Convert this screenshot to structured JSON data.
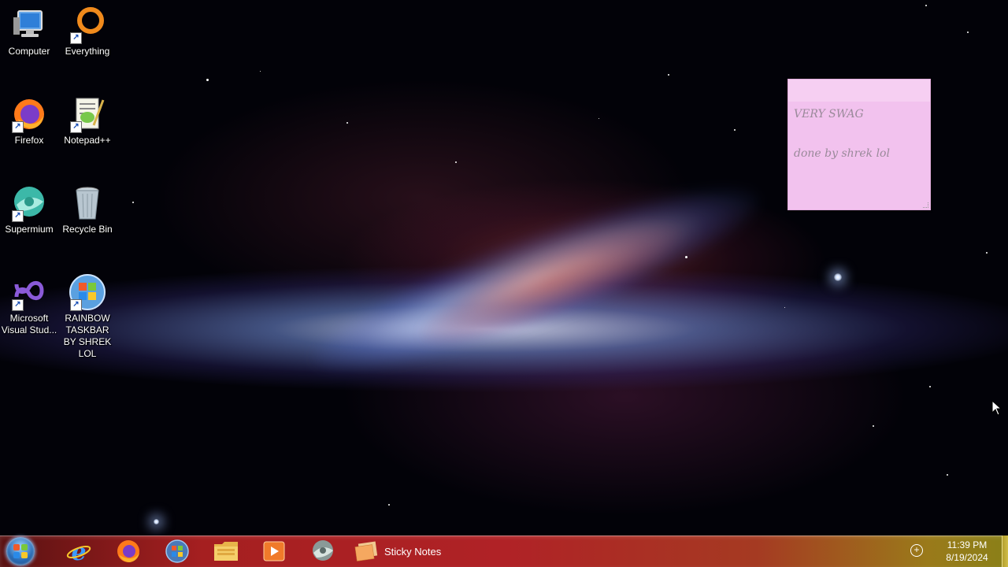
{
  "desktop_icons": [
    {
      "label": "Computer",
      "icon": "computer-icon"
    },
    {
      "label": "Everything",
      "icon": "everything-search-icon"
    },
    {
      "label": "Firefox",
      "icon": "firefox-icon"
    },
    {
      "label": "Notepad++",
      "icon": "notepad-plus-plus-icon"
    },
    {
      "label": "Supermium",
      "icon": "supermium-icon"
    },
    {
      "label": "Recycle Bin",
      "icon": "recycle-bin-icon"
    },
    {
      "label": "Microsoft Visual Stud...",
      "icon": "visual-studio-icon"
    },
    {
      "label": "RAINBOW TASKBAR BY SHREK LOL",
      "icon": "windows-logo-icon"
    }
  ],
  "sticky_note": {
    "line1": "VERY SWAG",
    "line2": "done by shrek lol",
    "color": "#f2c2ee"
  },
  "taskbar": {
    "pinned": [
      {
        "name": "internet-explorer",
        "icon": "internet-explorer-icon"
      },
      {
        "name": "firefox",
        "icon": "firefox-icon"
      },
      {
        "name": "windows-media-center",
        "icon": "windows-orb-icon"
      },
      {
        "name": "file-explorer",
        "icon": "folder-icon"
      },
      {
        "name": "media-player",
        "icon": "media-player-icon"
      },
      {
        "name": "supermium",
        "icon": "supermium-icon"
      }
    ],
    "running_app_label": "Sticky Notes",
    "clock_time": "11:39 PM",
    "clock_date": "8/19/2024"
  }
}
